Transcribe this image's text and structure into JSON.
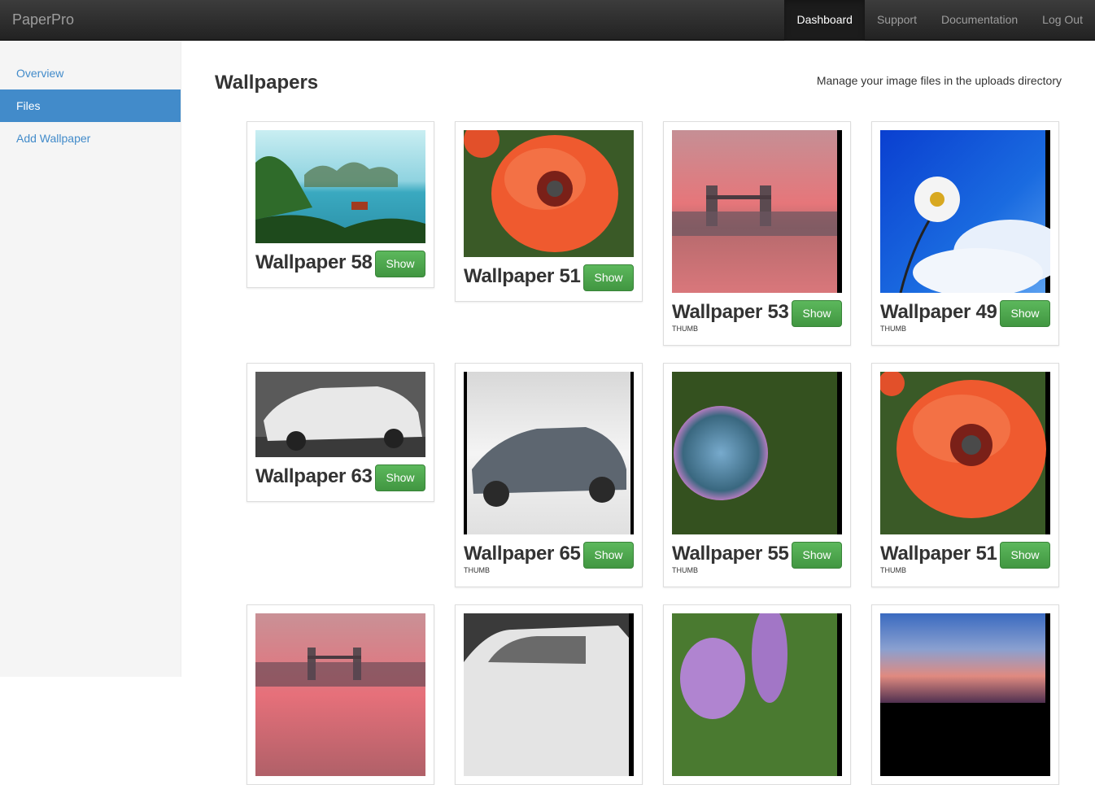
{
  "navbar": {
    "brand": "PaperPro",
    "links": [
      {
        "label": "Dashboard",
        "active": true
      },
      {
        "label": "Support"
      },
      {
        "label": "Documentation"
      },
      {
        "label": "Log Out"
      }
    ]
  },
  "sidebar": {
    "items": [
      {
        "label": "Overview"
      },
      {
        "label": "Files",
        "active": true
      },
      {
        "label": "Add Wallpaper"
      }
    ]
  },
  "main": {
    "title": "Wallpapers",
    "subtitle": "Manage your image files in the uploads directory",
    "button_label": "Show",
    "thumb_label": "THUMB",
    "cards": [
      {
        "title": "Wallpaper 58",
        "image": "bay-islands",
        "thumb": false
      },
      {
        "title": "Wallpaper 51",
        "image": "red-poppy",
        "thumb": false
      },
      {
        "title": "Wallpaper 53",
        "image": "tower-bridge-sunset",
        "thumb": true
      },
      {
        "title": "Wallpaper 49",
        "image": "daisy-blue-sky",
        "thumb": true
      },
      {
        "title": "Wallpaper 63",
        "image": "white-bmw",
        "thumb": false
      },
      {
        "title": "Wallpaper 65",
        "image": "grey-volvo",
        "thumb": true
      },
      {
        "title": "Wallpaper 55",
        "image": "soap-bubble",
        "thumb": true
      },
      {
        "title": "Wallpaper 51",
        "image": "red-poppy",
        "thumb": true
      },
      {
        "title": "",
        "image": "tower-bridge-sunset",
        "thumb": false
      },
      {
        "title": "",
        "image": "white-car",
        "thumb": false
      },
      {
        "title": "",
        "image": "purple-flower",
        "thumb": false
      },
      {
        "title": "",
        "image": "sunset-sky",
        "thumb": false
      }
    ]
  }
}
